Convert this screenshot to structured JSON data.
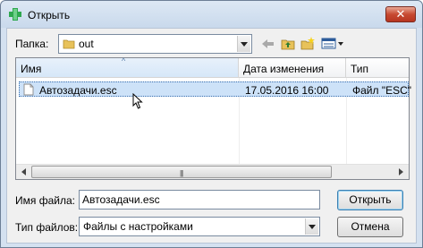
{
  "window": {
    "title": "Открыть",
    "close_glyph": "✕"
  },
  "location": {
    "label": "Папка:",
    "folder": "out"
  },
  "columns": [
    {
      "label": "Имя",
      "sort_glyph": "^"
    },
    {
      "label": "Дата изменения"
    },
    {
      "label": "Тип"
    }
  ],
  "files": [
    {
      "name": "Автозадачи.esc",
      "modified": "17.05.2016 16:00",
      "type": "Файл \"ESC\""
    }
  ],
  "file_name": {
    "label": "Имя файла:",
    "value": "Автозадачи.esc"
  },
  "file_type": {
    "label": "Тип файлов:",
    "value": "Файлы с настройками"
  },
  "buttons": {
    "open": "Открыть",
    "cancel": "Отмена"
  },
  "colors": {
    "accent": "#3c7fb1",
    "selection": "#cde2f8",
    "close": "#c74a32"
  }
}
